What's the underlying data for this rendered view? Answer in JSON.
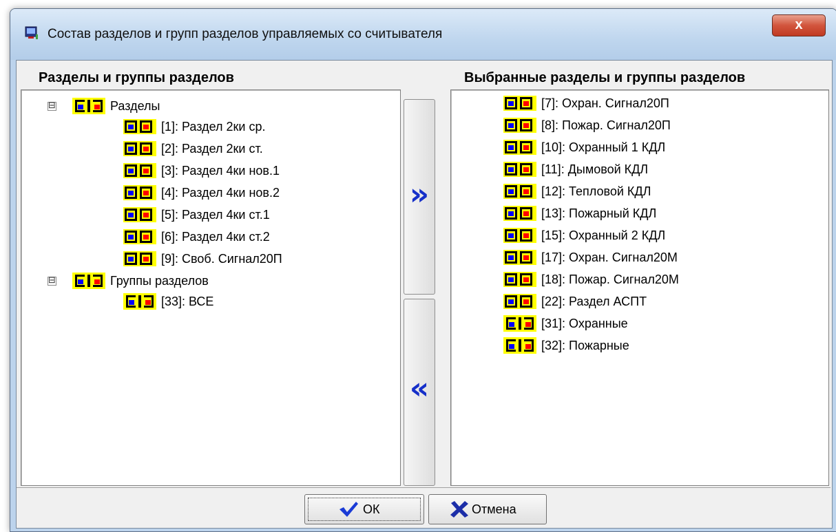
{
  "window": {
    "title": "Состав разделов и групп разделов управляемых со считывателя",
    "close_label": "x"
  },
  "left_panel": {
    "title": "Разделы и группы разделов",
    "groups": [
      {
        "label": "Разделы",
        "expander": "⊟",
        "items": [
          "[1]: Раздел 2ки ср.",
          "[2]: Раздел 2ки ст.",
          "[3]: Раздел 4ки нов.1",
          "[4]: Раздел 4ки нов.2",
          "[5]: Раздел 4ки ст.1",
          "[6]: Раздел 4ки ст.2",
          "[9]: Своб. Сигнал20П"
        ]
      },
      {
        "label": "Группы разделов",
        "expander": "⊟",
        "items": [
          "[33]: ВСЕ"
        ]
      }
    ]
  },
  "right_panel": {
    "title": "Выбранные разделы и группы разделов",
    "items": [
      {
        "label": "[7]: Охран. Сигнал20П",
        "icon": "partition-icon"
      },
      {
        "label": "[8]: Пожар. Сигнал20П",
        "icon": "partition-icon"
      },
      {
        "label": "[10]: Охранный 1 КДЛ",
        "icon": "partition-icon"
      },
      {
        "label": "[11]: Дымовой КДЛ",
        "icon": "partition-icon"
      },
      {
        "label": "[12]: Тепловой КДЛ",
        "icon": "partition-icon"
      },
      {
        "label": "[13]: Пожарный КДЛ",
        "icon": "partition-icon"
      },
      {
        "label": "[15]: Охранный 2 КДЛ",
        "icon": "partition-icon"
      },
      {
        "label": "[17]: Охран. Сигнал20М",
        "icon": "partition-icon"
      },
      {
        "label": "[18]: Пожар. Сигнал20М",
        "icon": "partition-icon"
      },
      {
        "label": "[22]: Раздел АСПТ",
        "icon": "partition-icon"
      },
      {
        "label": "[31]: Охранные",
        "icon": "partition-group-icon"
      },
      {
        "label": "[32]: Пожарные",
        "icon": "partition-group-icon"
      }
    ]
  },
  "move_buttons": {
    "add_glyph": "»",
    "remove_glyph": "«"
  },
  "buttons": {
    "ok_label": "ОК",
    "cancel_label": "Отмена"
  },
  "colors": {
    "icon_yellow": "#ffff00",
    "icon_blue": "#0000ff",
    "icon_red": "#ff0000",
    "arrow_blue": "#1630c9",
    "check_blue": "#1a3bd6",
    "cancel_x_blue": "#1c2ea8"
  }
}
